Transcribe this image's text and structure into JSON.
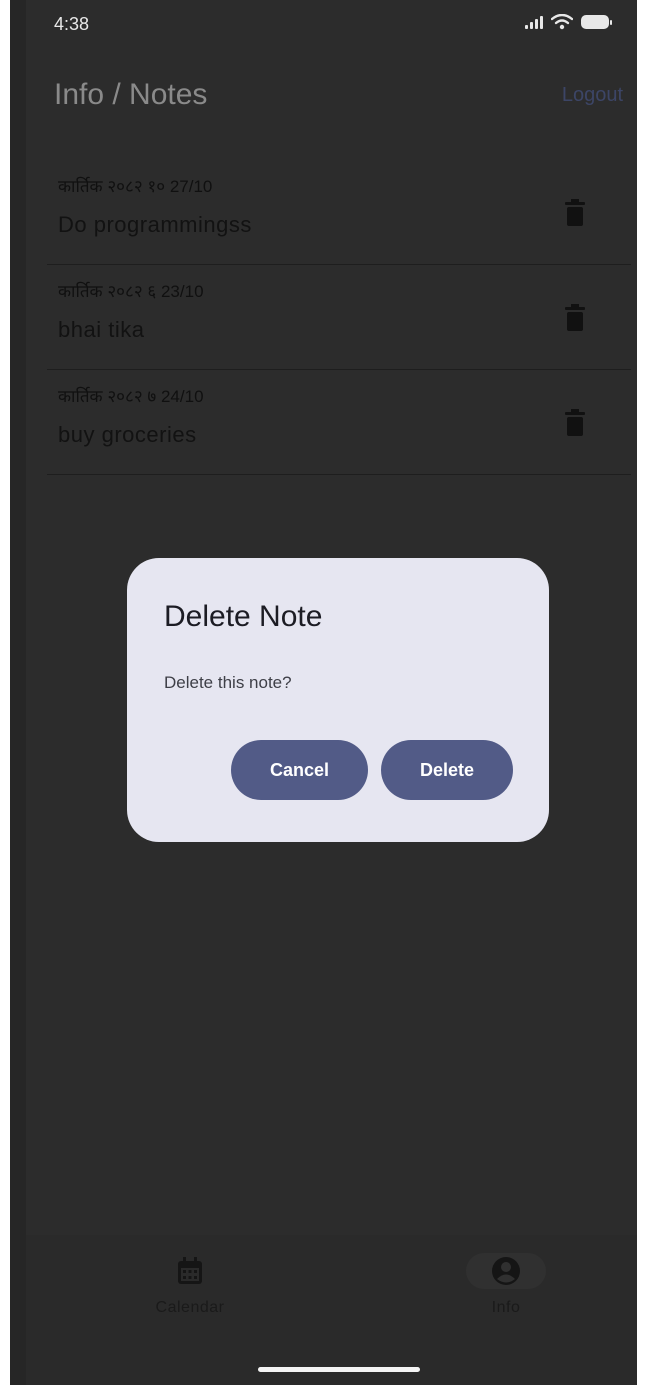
{
  "status_bar": {
    "time": "4:38"
  },
  "header": {
    "title": "Info / Notes",
    "logout_label": "Logout"
  },
  "notes": [
    {
      "date": "कार्तिक २०८२ १० 27/10",
      "text": "Do programmingss"
    },
    {
      "date": "कार्तिक २०८२ ६ 23/10",
      "text": "bhai tika"
    },
    {
      "date": "कार्तिक २०८२ ७ 24/10",
      "text": "buy groceries"
    }
  ],
  "dialog": {
    "title": "Delete Note",
    "message": "Delete this note?",
    "cancel_label": "Cancel",
    "delete_label": "Delete"
  },
  "bottom_nav": {
    "items": [
      {
        "label": "Calendar",
        "icon": "calendar-icon"
      },
      {
        "label": "Info",
        "icon": "account-circle-icon",
        "selected": true
      }
    ]
  },
  "colors": {
    "scrim_background": "#2c2c2c",
    "dialog_background": "#e6e6f1",
    "button_primary": "#525b87",
    "logout_text": "#3c4566"
  }
}
